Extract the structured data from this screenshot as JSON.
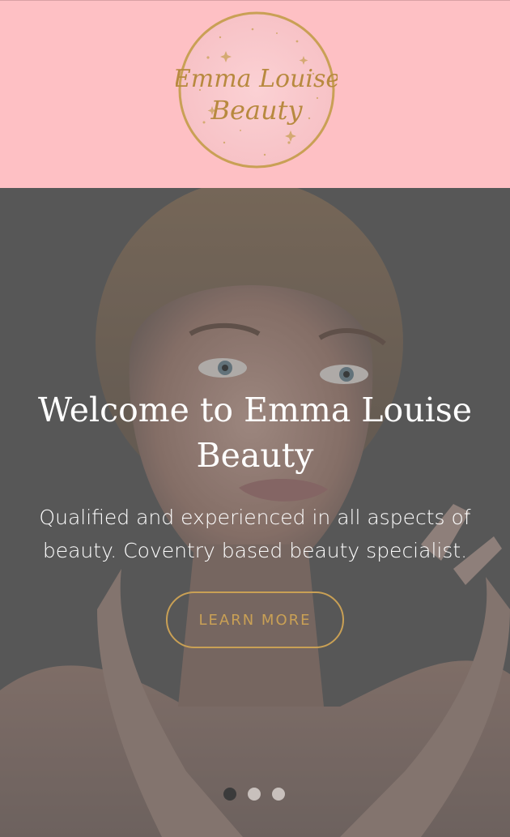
{
  "header": {
    "logo": {
      "line1": "Emma Louise",
      "line2": "Beauty",
      "colors": {
        "background": "#fec0c4",
        "gold": "#c9a055"
      }
    }
  },
  "hero": {
    "title": "Welcome to Emma Louise Beauty",
    "subtitle": "Qualified and experienced in all aspects of beauty. Coventry based beauty specialist.",
    "cta_label": "LEARN MORE",
    "carousel": {
      "slide_count": 3,
      "active_index": 0
    }
  },
  "colors": {
    "header_bg": "#fec0c4",
    "overlay": "#5f5f5f",
    "accent_gold": "#c9a055",
    "text": "#ffffff"
  }
}
